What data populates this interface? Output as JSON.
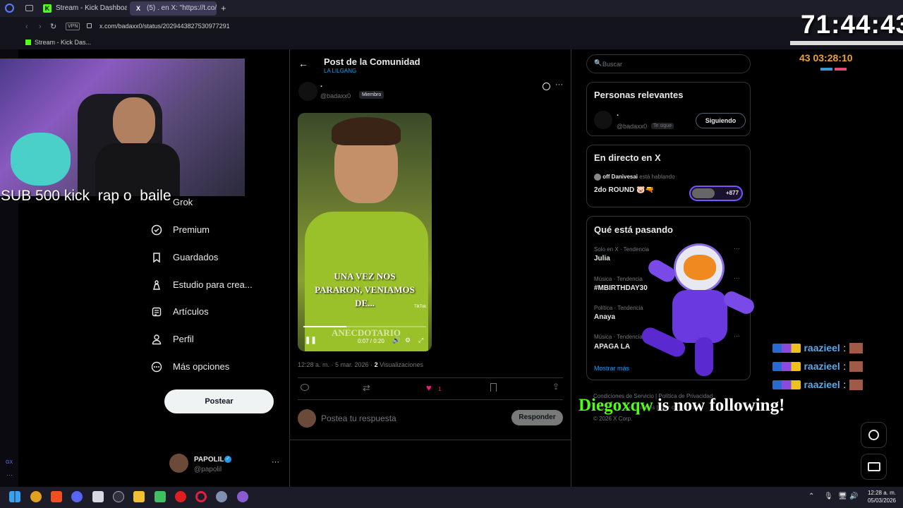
{
  "browser": {
    "tabs": [
      {
        "label": "Stream - Kick Dashboard",
        "color": "#53fc18"
      },
      {
        "label": "(5) . en X: \"https://t.co/",
        "color": "#ffffff"
      }
    ],
    "new_tab": "+",
    "vpn": "VPN",
    "url": "x.com/badaxx0/status/2029443827530977291",
    "bookmark": "Stream - Kick Das..."
  },
  "stream_overlay": {
    "timer": "71:44:43",
    "subtimer": "03:28:10",
    "subtimer_prefix": "43",
    "sub_goal": "SUB 500 kick  rap o  baile",
    "follow_user": "Diegoxqw",
    "follow_text": " is now following!",
    "chat_user": "raazieel",
    "chat_lines": [
      ":",
      ":",
      ":"
    ]
  },
  "x_nav": {
    "items": [
      {
        "label": "Grok",
        "icon": "grok-icon"
      },
      {
        "label": "Premium",
        "icon": "premium-icon"
      },
      {
        "label": "Guardados",
        "icon": "bookmark-icon"
      },
      {
        "label": "Estudio para crea...",
        "icon": "studio-icon"
      },
      {
        "label": "Artículos",
        "icon": "articles-icon"
      },
      {
        "label": "Perfil",
        "icon": "profile-icon"
      },
      {
        "label": "Más opciones",
        "icon": "more-icon"
      }
    ],
    "post_button": "Postear",
    "account_name": "PAPOLIL",
    "account_handle": "@papolil",
    "account_more": "···"
  },
  "post": {
    "header_title": "Post de la Comunidad",
    "header_sub": "LA LILGANG",
    "author_name": ".",
    "author_handle": "@badaxx0",
    "author_badge": "Miembro",
    "video_caption_1": "UNA VEZ NOS",
    "video_caption_2": "PARARON, VENIAMOS",
    "video_caption_3": "DE...",
    "video_watermark": "ANECDOTARIO",
    "video_tiktok": "TikTok",
    "video_time": "0:07 / 0:20",
    "timestamp": "12:28 a. m. · 5 mar. 2026 · ",
    "views_count": "2",
    "views_label": " Visualizaciones",
    "likes": "1",
    "reply_placeholder": "Postea tu respuesta",
    "reply_button": "Responder"
  },
  "sidebar": {
    "search_placeholder": "Buscar",
    "relevant_title": "Personas relevantes",
    "relevant_name": ".",
    "relevant_handle": "@badaxx0",
    "relevant_badge": "Te sigue",
    "follow_button": "Siguiendo",
    "live_title": "En directo en X",
    "live_host": "off Danivesai",
    "live_status": " está hablando",
    "live_topic": "2do ROUND 🐷🔫",
    "live_count": "+877",
    "trending_title": "Qué está pasando",
    "trends": [
      {
        "meta": "Solo en X · Tendencia",
        "name": "Julia"
      },
      {
        "meta": "Música · Tendencia",
        "name": "#MBIRTHDAY30"
      },
      {
        "meta": "Política · Tendencia",
        "name": "Anaya"
      },
      {
        "meta": "Música · Tendencia",
        "name": "APAGA LA"
      }
    ],
    "show_more": "Mostrar más",
    "footer_1": "Condiciones de Servicio",
    "footer_2": "Política de Privacidad",
    "footer_3": "Información de anuncios",
    "footer_4": "Más opciones",
    "footer_copy": "© 2026 X Corp."
  },
  "taskbar": {
    "time": "12:28 a. m.",
    "date": "05/03/2026"
  }
}
